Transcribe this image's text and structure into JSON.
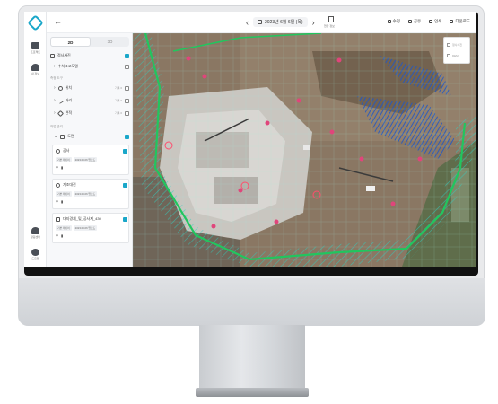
{
  "topbar": {
    "date": "2023년 6월 6일 (목)",
    "doc_label": "현장 정보",
    "tools": [
      {
        "icon": "pencil-icon",
        "label": "수정"
      },
      {
        "icon": "share-icon",
        "label": "공유"
      },
      {
        "icon": "print-icon",
        "label": "인쇄"
      },
      {
        "icon": "download-icon",
        "label": "다운로드"
      }
    ]
  },
  "rail": {
    "items": [
      {
        "icon": "folder-icon",
        "label": "프로젝트"
      },
      {
        "icon": "user-icon",
        "label": "내 정보"
      },
      {
        "icon": "bell-icon",
        "label": "알림센터"
      },
      {
        "icon": "help-icon",
        "label": "도움말"
      }
    ]
  },
  "panel": {
    "tabs": [
      "2D",
      "3D"
    ],
    "base_row": "정사사진",
    "sub_row": "수치표고모델",
    "section1": "측정 도구",
    "tools": [
      {
        "label": "위치",
        "meta": "기록 0"
      },
      {
        "label": "거리",
        "meta": "기록 0"
      },
      {
        "label": "면적",
        "meta": "기록 0"
      }
    ],
    "section2": "작업 관리",
    "group": "도면",
    "cards": [
      {
        "title": "공사",
        "chips": [
          "기본 레이어",
          "2023.06.06 업로드"
        ]
      },
      {
        "title": "가조대전",
        "chips": [
          "기본 레이어",
          "2023.06.06 업로드"
        ]
      },
      {
        "title": "대지경계_및_공사지_430",
        "chips": [
          "기본 레이어",
          "2023.06.06 업로드"
        ]
      }
    ]
  },
  "map": {
    "layer_options": [
      "정사사진",
      "DEM"
    ]
  }
}
